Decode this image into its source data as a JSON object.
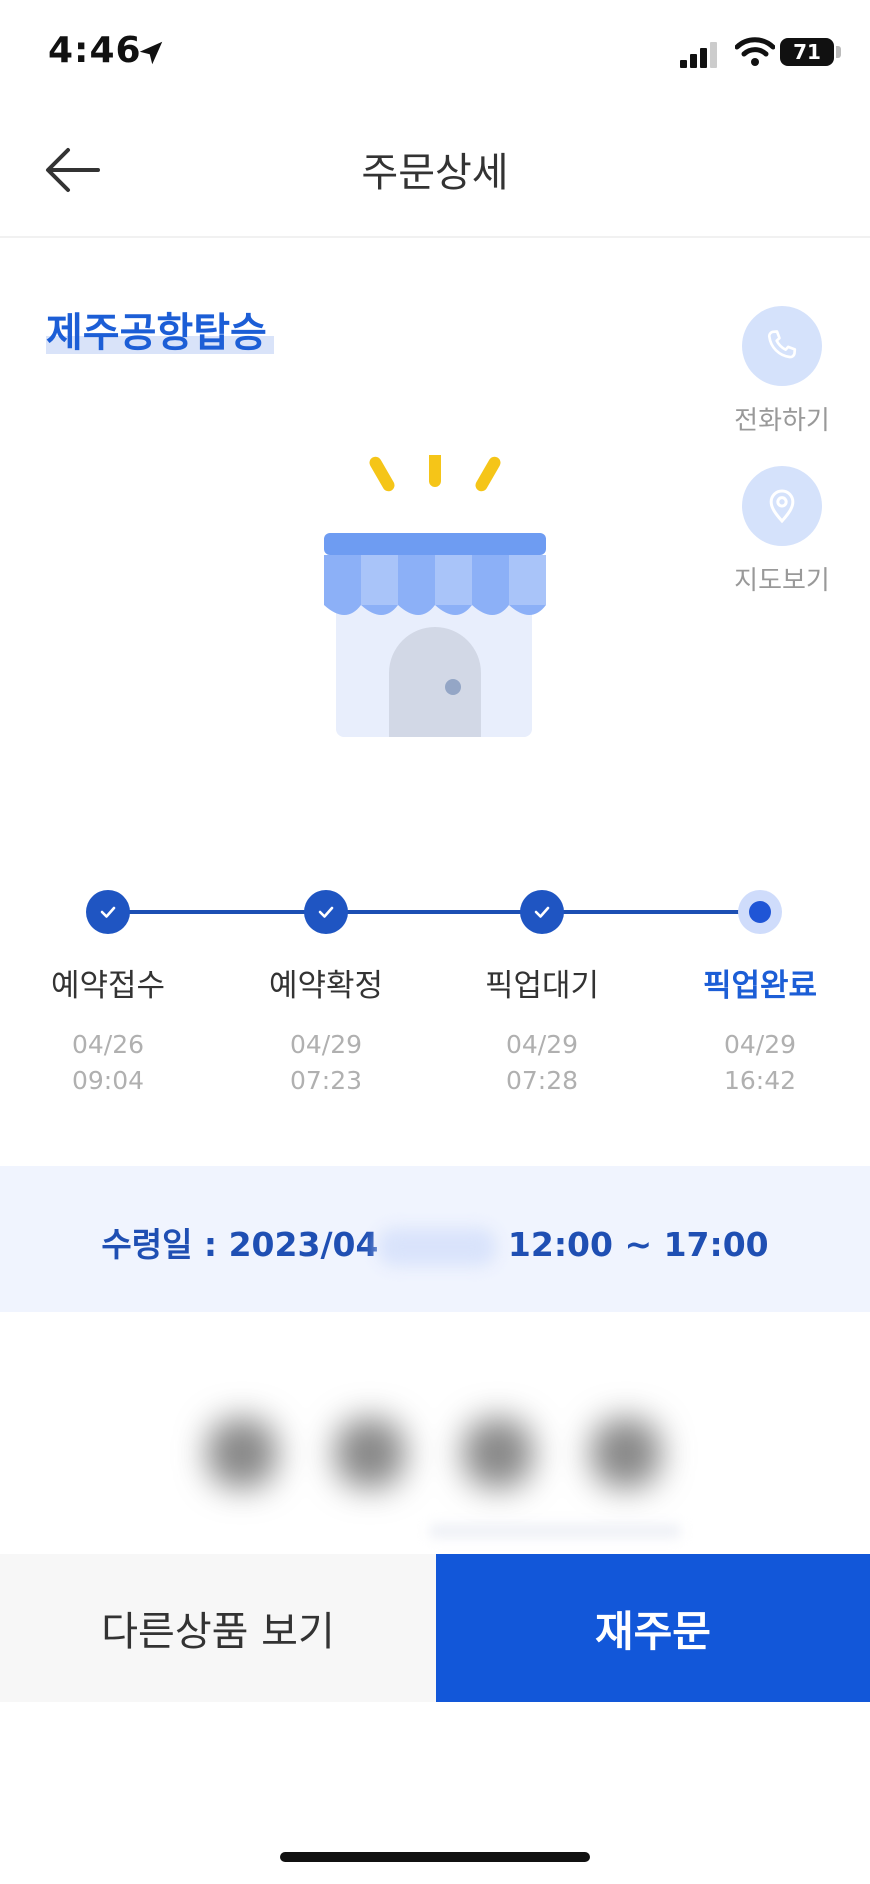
{
  "status_bar": {
    "time": "4:46",
    "battery": "71"
  },
  "header": {
    "title": "주문상세"
  },
  "store": {
    "name": "제주공항탑승",
    "call_label": "전화하기",
    "map_label": "지도보기"
  },
  "steps": [
    {
      "label": "예약접수",
      "date": "04/26",
      "time": "09:04",
      "state": "done"
    },
    {
      "label": "예약확정",
      "date": "04/29",
      "time": "07:23",
      "state": "done"
    },
    {
      "label": "픽업대기",
      "date": "04/29",
      "time": "07:28",
      "state": "done"
    },
    {
      "label": "픽업완료",
      "date": "04/29",
      "time": "16:42",
      "state": "current"
    }
  ],
  "receive": {
    "prefix": "수령일 : 2023/04",
    "suffix": "12:00 ~ 17:00"
  },
  "buttons": {
    "other": "다른상품 보기",
    "reorder": "재주문"
  },
  "colors": {
    "accent": "#1257d9",
    "band": "#f0f4fe"
  }
}
